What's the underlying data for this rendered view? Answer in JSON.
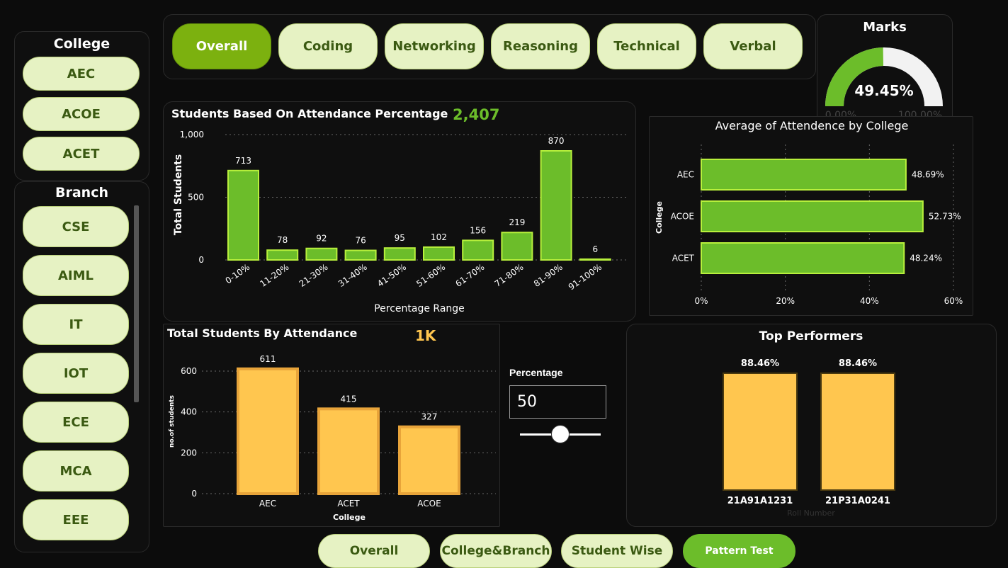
{
  "colors": {
    "accent_green": "#7cb10f",
    "bar_green": "#6cbd2a",
    "bar_yellow": "#ffc64f",
    "pill_bg": "#e6f2c3"
  },
  "sidebar": {
    "college_title": "College",
    "colleges": [
      "AEC",
      "ACOE",
      "ACET"
    ],
    "branch_title": "Branch",
    "branches": [
      "CSE",
      "AIML",
      "IT",
      "IOT",
      "ECE",
      "MCA",
      "EEE"
    ]
  },
  "tabs": [
    "Overall",
    "Coding",
    "Networking",
    "Reasoning",
    "Technical",
    "Verbal"
  ],
  "active_tab": "Overall",
  "marks_gauge": {
    "title": "Marks",
    "value_label": "49.45%",
    "value": 49.45,
    "min_label": "0.00%",
    "max_label": "100.00%"
  },
  "attendance_chart": {
    "title": "Students Based On Attendance Percentage",
    "total_label": "2,407"
  },
  "college_avg_chart": {
    "title": "Average of Attendence by College"
  },
  "students_by_attendance": {
    "title": "Total Students By Attendance",
    "kpi": "1K"
  },
  "percentage_filter": {
    "label": "Percentage",
    "value": "50"
  },
  "top_performers": {
    "title": "Top Performers",
    "xlabel": "Roll Number"
  },
  "bottom_nav": [
    "Overall",
    "College&Branch",
    "Student Wise",
    "Pattern Test"
  ],
  "bottom_active": "Pattern Test",
  "chart_data": [
    {
      "type": "bar",
      "title": "Students Based On Attendance Percentage",
      "xlabel": "Percentage Range",
      "ylabel": "Total Students",
      "categories": [
        "0-10%",
        "11-20%",
        "21-30%",
        "31-40%",
        "41-50%",
        "51-60%",
        "61-70%",
        "71-80%",
        "81-90%",
        "91-100%"
      ],
      "values": [
        713,
        78,
        92,
        76,
        95,
        102,
        156,
        219,
        870,
        6
      ],
      "ylim": [
        0,
        1000
      ],
      "yticks": [
        0,
        500,
        1000
      ],
      "ytick_labels": [
        "0",
        "500",
        "1,000"
      ],
      "grid": true
    },
    {
      "type": "bar",
      "orientation": "horizontal",
      "title": "Average of Attendence by College",
      "ylabel": "College",
      "categories": [
        "AEC",
        "ACOE",
        "ACET"
      ],
      "values": [
        48.69,
        52.73,
        48.24
      ],
      "value_labels": [
        "48.69%",
        "52.73%",
        "48.24%"
      ],
      "xlim": [
        0,
        60
      ],
      "xticks": [
        0,
        20,
        40,
        60
      ],
      "xtick_labels": [
        "0%",
        "20%",
        "40%",
        "60%"
      ],
      "grid": true
    },
    {
      "type": "bar",
      "title": "Total Students By Attendance",
      "xlabel": "College",
      "ylabel": "no.of students",
      "categories": [
        "AEC",
        "ACET",
        "ACOE"
      ],
      "values": [
        611,
        415,
        327
      ],
      "ylim": [
        0,
        600
      ],
      "yticks": [
        0,
        200,
        400,
        600
      ],
      "grid": true
    },
    {
      "type": "bar",
      "title": "Top Performers",
      "xlabel": "Roll Number",
      "categories": [
        "21A91A1231",
        "21P31A0241"
      ],
      "values": [
        88.46,
        88.46
      ],
      "value_labels": [
        "88.46%",
        "88.46%"
      ]
    }
  ]
}
